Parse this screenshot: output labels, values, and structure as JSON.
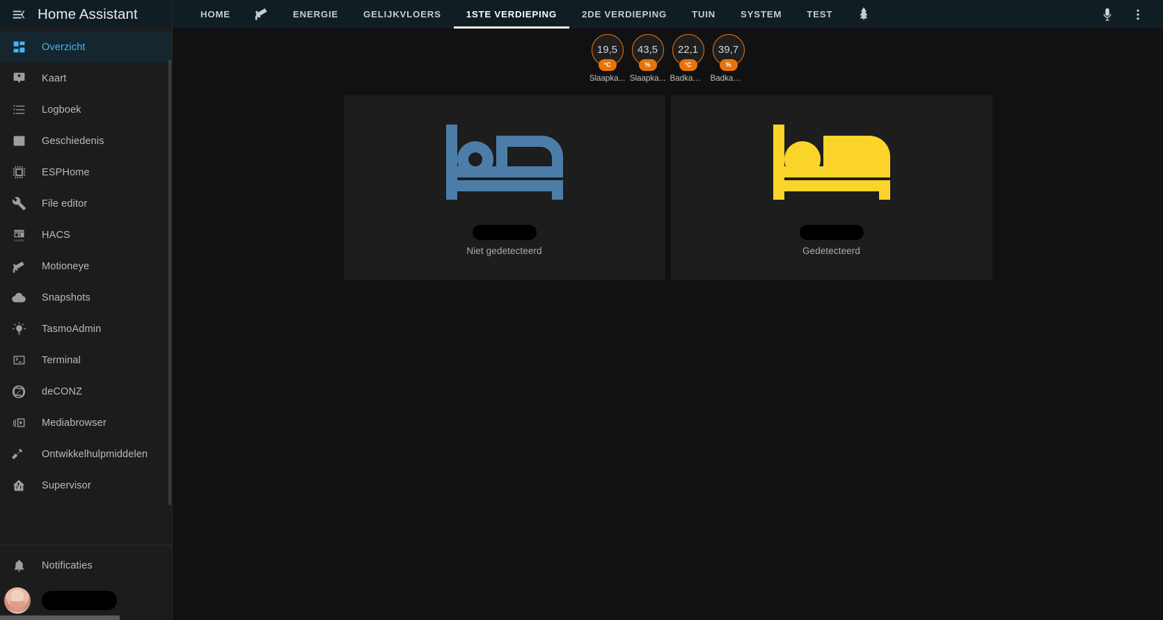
{
  "app": {
    "title": "Home Assistant",
    "menu_icon": "menu-collapse-icon",
    "accent_color": "#45b6f3",
    "badge_color": "#e8730c",
    "card_bg": "#1d1d1d",
    "bed_off_color": "#4c7da8",
    "bed_on_color": "#fbd429"
  },
  "sidebar": {
    "items": [
      {
        "label": "Overzicht",
        "icon": "view-dashboard-icon",
        "active": true
      },
      {
        "label": "Kaart",
        "icon": "map-marker-account-icon",
        "active": false
      },
      {
        "label": "Logboek",
        "icon": "format-list-bulleted-icon",
        "active": false
      },
      {
        "label": "Geschiedenis",
        "icon": "chart-box-icon",
        "active": false
      },
      {
        "label": "ESPHome",
        "icon": "chip-icon",
        "active": false
      },
      {
        "label": "File editor",
        "icon": "wrench-icon",
        "active": false
      },
      {
        "label": "HACS",
        "icon": "hacs-store-icon",
        "active": false
      },
      {
        "label": "Motioneye",
        "icon": "cctv-camera-icon",
        "active": false
      },
      {
        "label": "Snapshots",
        "icon": "cloud-icon",
        "active": false
      },
      {
        "label": "TasmoAdmin",
        "icon": "lightbulb-on-icon",
        "active": false
      },
      {
        "label": "Terminal",
        "icon": "console-icon",
        "active": false
      },
      {
        "label": "deCONZ",
        "icon": "zigbee-icon",
        "active": false
      },
      {
        "label": "Mediabrowser",
        "icon": "play-box-multiple-icon",
        "active": false
      },
      {
        "label": "Ontwikkelhulpmiddelen",
        "icon": "hammer-icon",
        "active": false
      },
      {
        "label": "Supervisor",
        "icon": "home-assistant-supervisor-icon",
        "active": false
      }
    ],
    "notifications": {
      "label": "Notificaties",
      "icon": "bell-icon"
    },
    "user": {
      "name_redacted": true,
      "avatar": "user-avatar"
    }
  },
  "topbar": {
    "tabs": [
      {
        "label": "HOME",
        "type": "text",
        "active": false
      },
      {
        "label": "",
        "type": "icon",
        "icon": "cctv-camera-icon",
        "active": false
      },
      {
        "label": "ENERGIE",
        "type": "text",
        "active": false
      },
      {
        "label": "GELIJKVLOERS",
        "type": "text",
        "active": false
      },
      {
        "label": "1STE VERDIEPING",
        "type": "text",
        "active": true
      },
      {
        "label": "2DE VERDIEPING",
        "type": "text",
        "active": false
      },
      {
        "label": "TUIN",
        "type": "text",
        "active": false
      },
      {
        "label": "SYSTEM",
        "type": "text",
        "active": false
      },
      {
        "label": "TEST",
        "type": "text",
        "active": false
      },
      {
        "label": "",
        "type": "icon",
        "icon": "pine-tree-icon",
        "active": false
      }
    ],
    "actions": [
      {
        "name": "assist-microphone-button",
        "icon": "microphone-icon"
      },
      {
        "name": "overflow-menu-button",
        "icon": "dots-vertical-icon"
      }
    ]
  },
  "view": {
    "badges": [
      {
        "value": "19,5",
        "unit": "°C",
        "name": "Slaapka...",
        "unit_type": "temperature"
      },
      {
        "value": "43,5",
        "unit": "%",
        "name": "Slaapka...",
        "unit_type": "humidity"
      },
      {
        "value": "22,1",
        "unit": "°C",
        "name": "Badkamer",
        "unit_type": "temperature"
      },
      {
        "value": "39,7",
        "unit": "%",
        "name": "Badkamer",
        "unit_type": "humidity"
      }
    ],
    "cards": [
      {
        "icon": "bed-empty-icon",
        "icon_state": "off",
        "name_redacted": true,
        "state": "Niet gedetecteerd"
      },
      {
        "icon": "bed-occupied-icon",
        "icon_state": "on",
        "name_redacted": true,
        "state": "Gedetecteerd"
      }
    ]
  }
}
